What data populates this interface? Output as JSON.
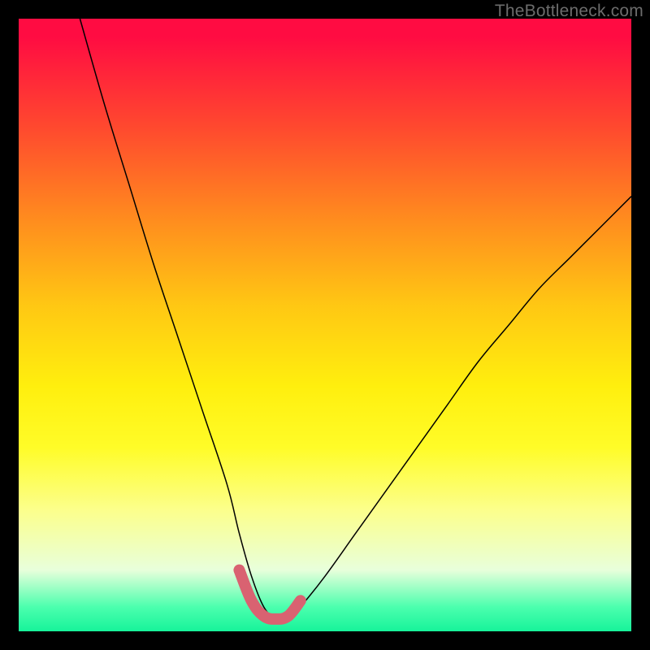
{
  "watermark": {
    "text": "TheBottleneck.com"
  },
  "chart_data": {
    "type": "line",
    "title": "",
    "xlabel": "",
    "ylabel": "",
    "xlim": [
      0,
      100
    ],
    "ylim": [
      0,
      100
    ],
    "grid": false,
    "legend": false,
    "series": [
      {
        "name": "bottleneck-curve-full",
        "note": "V-shaped bottleneck curve; minimum near x≈40; y is percentage of chart height from bottom",
        "x": [
          10,
          14,
          18,
          22,
          26,
          30,
          34,
          36,
          38,
          40,
          42,
          44,
          46,
          50,
          55,
          60,
          65,
          70,
          75,
          80,
          85,
          90,
          95,
          100
        ],
        "y": [
          100,
          86,
          73,
          60,
          48,
          36,
          24,
          16,
          9,
          4,
          2,
          2,
          4,
          9,
          16,
          23,
          30,
          37,
          44,
          50,
          56,
          61,
          66,
          71
        ]
      },
      {
        "name": "bottleneck-curve-highlight",
        "note": "Thick pink highlighted segment near the trough where bottleneck is minimal",
        "x": [
          36,
          38,
          40,
          42,
          44,
          46
        ],
        "y": [
          10,
          5,
          2.5,
          2,
          2.5,
          5
        ]
      }
    ]
  }
}
